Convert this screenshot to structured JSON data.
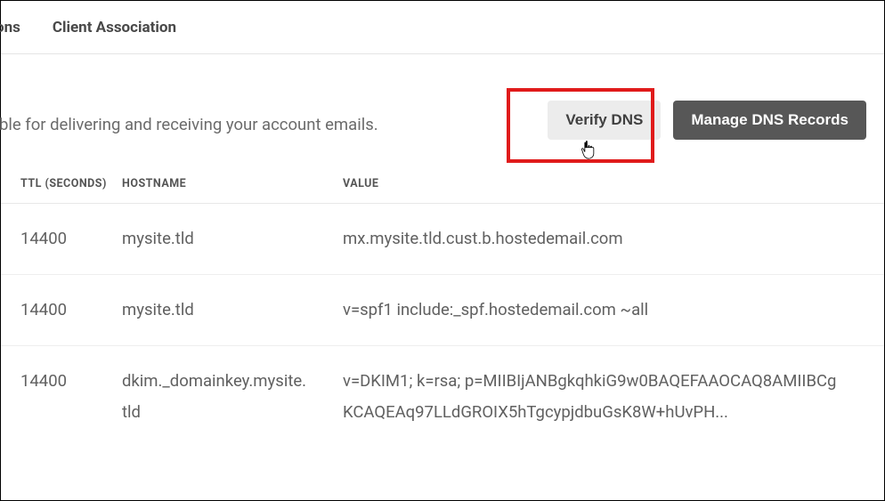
{
  "tabs": {
    "partial": "ons",
    "client_association": "Client Association"
  },
  "description": "ble for delivering and receiving your account emails.",
  "buttons": {
    "verify_dns": "Verify DNS",
    "manage_dns": "Manage DNS Records"
  },
  "table": {
    "headers": {
      "ttl": "TTL (SECONDS)",
      "hostname": "HOSTNAME",
      "value": "VALUE"
    },
    "rows": [
      {
        "ttl": "14400",
        "hostname": "mysite.tld",
        "value": "mx.mysite.tld.cust.b.hostedemail.com"
      },
      {
        "ttl": "14400",
        "hostname": "mysite.tld",
        "value": "v=spf1 include:_spf.hostedemail.com ~all"
      },
      {
        "ttl": "14400",
        "hostname": "dkim._domainkey.mysite.tld",
        "value": "v=DKIM1; k=rsa; p=MIIBIjANBgkqhkiG9w0BAQEFAAOCAQ8AMIIBCgKCAQEAq97LLdGROIX5hTgcypjdbuGsK8W+hUvPH..."
      }
    ]
  }
}
